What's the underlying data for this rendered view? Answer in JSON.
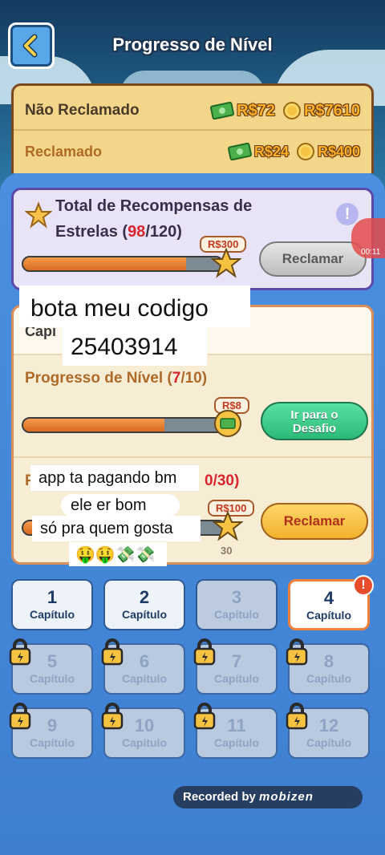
{
  "header": {
    "title": "Progresso de Nível",
    "back_icon": "chevron-left-icon"
  },
  "claims": {
    "unclaimed": {
      "label": "Não Reclamado",
      "cash": "R$72",
      "coins": "R$7610"
    },
    "claimed": {
      "label": "Reclamado",
      "cash": "R$24",
      "coins": "R$400"
    }
  },
  "stars": {
    "title_prefix": "Total de Recompensas de Estrelas (",
    "current": "98",
    "total_suffix": "/120)",
    "reward": "R$300",
    "button": "Reclamar",
    "progress": 0.82
  },
  "overlay": {
    "code_line1": "bota meu codigo",
    "code_line2": "25403914",
    "msg1": "app ta pagando bm",
    "msg2": "ele er bom",
    "msg3": "só pra quem gosta",
    "emojis": "🤑🤑💸💸"
  },
  "chapter_progress": {
    "header_label": "Capí",
    "level_title_prefix": "Progresso de Nível (",
    "level_current": "7",
    "level_suffix": "/10)",
    "level_reward": "R$8",
    "level_button_line1": "Ir para o",
    "level_button_line2": "Desafio",
    "level_progress": 0.7,
    "second_prefix": "P",
    "second_value": "0/30)",
    "second_reward": "R$100",
    "second_button": "Reclamar",
    "second_count": "30",
    "second_progress": 0.85
  },
  "chapters": [
    {
      "num": "1",
      "label": "Capítulo",
      "state": "open"
    },
    {
      "num": "2",
      "label": "Capítulo",
      "state": "open"
    },
    {
      "num": "3",
      "label": "Capítulo",
      "state": "dim"
    },
    {
      "num": "4",
      "label": "Capítulo",
      "state": "active"
    },
    {
      "num": "5",
      "label": "Capítulo",
      "state": "locked"
    },
    {
      "num": "6",
      "label": "Capítulo",
      "state": "locked"
    },
    {
      "num": "7",
      "label": "Capítulo",
      "state": "locked"
    },
    {
      "num": "8",
      "label": "Capítulo",
      "state": "locked"
    },
    {
      "num": "9",
      "label": "Capítulo",
      "state": "locked"
    },
    {
      "num": "10",
      "label": "Capítulo",
      "state": "locked"
    },
    {
      "num": "11",
      "label": "Capítulo",
      "state": "locked"
    },
    {
      "num": "12",
      "label": "Capítulo",
      "state": "locked"
    }
  ],
  "recorder": {
    "text": "Recorded by",
    "brand": "mobizen",
    "time": "00:11"
  }
}
